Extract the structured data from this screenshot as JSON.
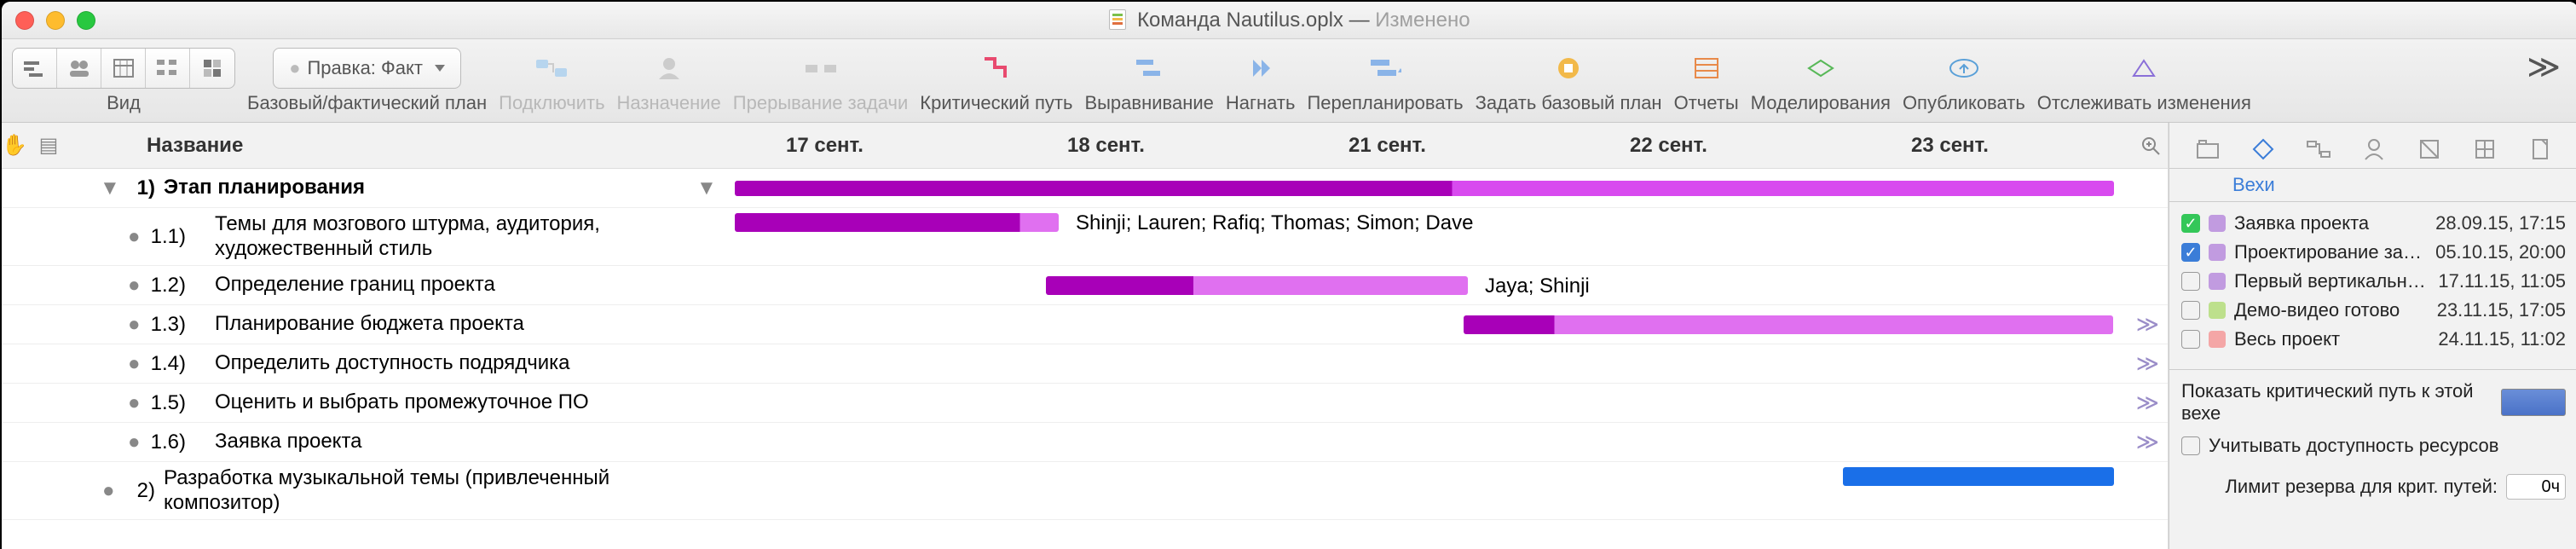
{
  "title": {
    "filename": "Команда Nautilus.oplx",
    "status": "Изменено"
  },
  "toolbar": {
    "view": "Вид",
    "baseline": "Базовый/фактический план",
    "baseline_select_bullet": "●",
    "baseline_select": "Правка: Факт",
    "connect": "Подключить",
    "assign": "Назначение",
    "split": "Прерывание задачи",
    "critical": "Критический путь",
    "level": "Выравнивание",
    "catchup": "Нагнать",
    "reschedule": "Перепланировать",
    "set_baseline": "Задать базовый план",
    "reports": "Отчеты",
    "sim": "Моделирования",
    "publish": "Опубликовать",
    "track": "Отслеживать изменения"
  },
  "header": {
    "name": "Название",
    "dates": [
      "17 сент.",
      "18 сент.",
      "21 сент.",
      "22 сент.",
      "23 сент."
    ]
  },
  "tasks": [
    {
      "num": "1)",
      "title": "Этап планирования",
      "indent": 0,
      "disclosure": "▼",
      "bullet": "▼"
    },
    {
      "num": "1.1)",
      "title": "Темы для мозгового штурма, аудитория, художественный стиль",
      "indent": 1,
      "bullet": "●",
      "label": "Shinji; Lauren; Rafiq; Thomas; Simon; Dave"
    },
    {
      "num": "1.2)",
      "title": "Определение границ проекта",
      "indent": 1,
      "bullet": "●",
      "label": "Jaya; Shinji"
    },
    {
      "num": "1.3)",
      "title": "Планирование бюджета проекта",
      "indent": 1,
      "bullet": "●",
      "arrow": "≫"
    },
    {
      "num": "1.4)",
      "title": "Определить доступность подрядчика",
      "indent": 1,
      "bullet": "●",
      "arrow": "≫"
    },
    {
      "num": "1.5)",
      "title": "Оценить и выбрать промежуточное ПО",
      "indent": 1,
      "bullet": "●",
      "arrow": "≫"
    },
    {
      "num": "1.6)",
      "title": "Заявка проекта",
      "indent": 1,
      "bullet": "●",
      "arrow": "≫"
    },
    {
      "num": "2)",
      "title": "Разработка музыкальной темы (привлеченный композитор)",
      "indent": 0,
      "bullet": "●"
    }
  ],
  "inspector": {
    "section_title": "Вехи",
    "milestones": [
      {
        "checked": "green",
        "color": "#c19be0",
        "label": "Заявка проекта",
        "date": "28.09.15, 17:15"
      },
      {
        "checked": "blue",
        "color": "#c19be0",
        "label": "Проектирование завершено",
        "date": "05.10.15, 20:00"
      },
      {
        "checked": "",
        "color": "#c19be0",
        "label": "Первый вертикальный сре…",
        "date": "17.11.15, 11:05"
      },
      {
        "checked": "",
        "color": "#bde08c",
        "label": "Демо-видео готово",
        "date": "23.11.15, 17:05"
      },
      {
        "checked": "",
        "color": "#f4a6a6",
        "label": "Весь проект",
        "date": "24.11.15, 11:02"
      }
    ],
    "crit_label": "Показать критический путь к этой вехе",
    "avail_label": "Учитывать доступность ресурсов",
    "slack_label": "Лимит резерва для крит. путей:",
    "slack_value": "0ч"
  },
  "date_x": [
    960,
    1290,
    1620,
    1950,
    2280
  ],
  "overflow": "≫"
}
